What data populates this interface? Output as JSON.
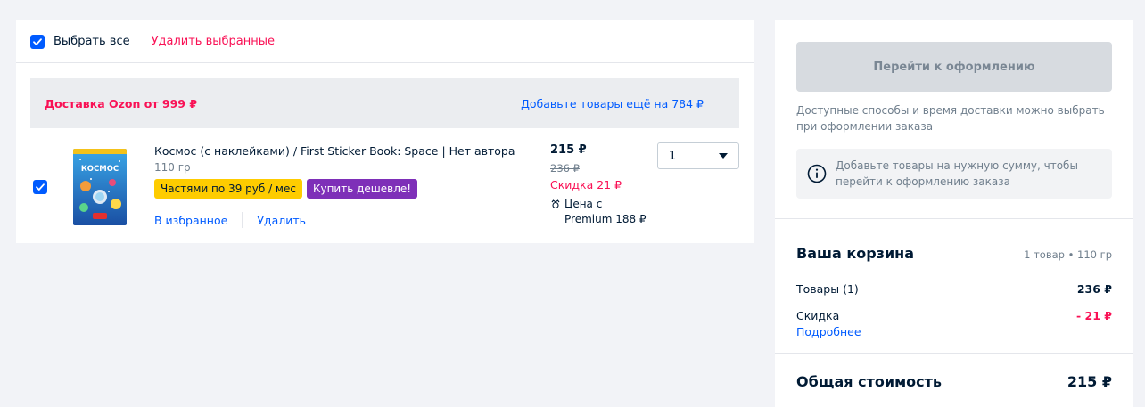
{
  "colors": {
    "accent_blue": "#005bff",
    "accent_pink": "#f91155",
    "badge_yellow": "#fecc00",
    "badge_purple": "#7e2fb8",
    "page_bg": "#f2f3f7"
  },
  "selection": {
    "select_all_label": "Выбрать все",
    "delete_selected_label": "Удалить выбранные"
  },
  "delivery": {
    "title": "Доставка Ozon от 999 ₽",
    "add_goods_link": "Добавьте товары ещё на 784 ₽"
  },
  "item": {
    "title": "Космос (с наклейками) / First Sticker Book: Space | Нет автора",
    "weight": "110 гр",
    "badge_installment": "Частями по 39 руб / мес",
    "badge_cheaper": "Купить дешевле!",
    "favorite_link": "В избранное",
    "delete_link": "Удалить",
    "price_current": "215 ₽",
    "price_old": "236 ₽",
    "price_discount": "Скидка 21 ₽",
    "premium_line1": "Цена с",
    "premium_line2": "Premium 188 ₽",
    "quantity": "1",
    "cover_title": "КОСМОС"
  },
  "summary": {
    "checkout_button": "Перейти к оформлению",
    "delivery_note": "Доступные способы и время доставки можно выбрать при оформлении заказа",
    "info_text": "Добавьте товары на нужную сумму, чтобы перейти к оформлению заказа",
    "cart_title": "Ваша корзина",
    "cart_meta": "1 товар • 110 гр",
    "goods_label": "Товары (1)",
    "goods_value": "236 ₽",
    "discount_label": "Скидка",
    "discount_value": "- 21 ₽",
    "details_link": "Подробнее",
    "total_label": "Общая стоимость",
    "total_value": "215 ₽"
  }
}
